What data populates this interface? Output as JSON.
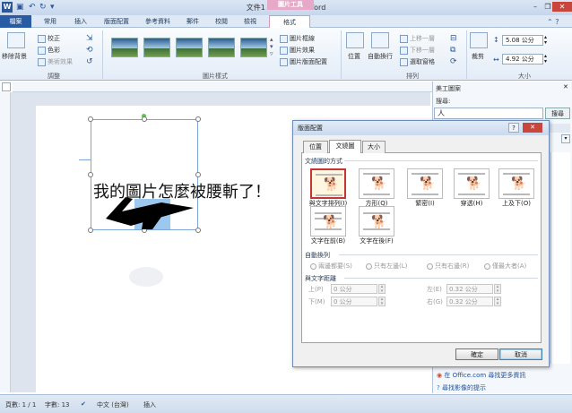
{
  "window": {
    "title": "文件1 - Microsoft Word",
    "context_tab_group": "圖片工具",
    "controls": [
      "–",
      "❐",
      "✕"
    ]
  },
  "tabs": [
    "檔案",
    "常用",
    "插入",
    "版面配置",
    "參考資料",
    "郵件",
    "校閱",
    "檢視",
    "格式"
  ],
  "ribbon": {
    "adjust": {
      "remove_bg": "移除背景",
      "correct": "校正",
      "color": "色彩",
      "effects": "美術效果",
      "group_label": "調整"
    },
    "styles": {
      "border": "圖片框線",
      "effects": "圖片效果",
      "layout": "圖片版面配置",
      "group_label": "圖片樣式"
    },
    "arrange": {
      "position": "位置",
      "wrap": "自動換行",
      "bring_forward": "上移一層",
      "send_backward": "下移一層",
      "selection_pane": "選取窗格",
      "group_label": "排列"
    },
    "size": {
      "crop": "裁剪",
      "height": "5.08 公分",
      "width": "4.92 公分",
      "group_label": "大小"
    }
  },
  "document": {
    "text": "我的圖片怎麼被腰斬了！"
  },
  "task_pane": {
    "title": "美工圖案",
    "search_label": "搜尋:",
    "search_value": "人",
    "search_button": "搜尋",
    "link1": "在 Office.com 尋找更多資訊",
    "link2": "尋找影像的提示"
  },
  "dialog": {
    "title": "版面配置",
    "help": "?",
    "close": "✕",
    "tabs": [
      "位置",
      "文繞圖",
      "大小"
    ],
    "active_tab": "文繞圖",
    "wrap_section": "文繞圖的方式",
    "wrap_options": [
      {
        "label": "與文字排列(I)",
        "selected": true
      },
      {
        "label": "方形(Q)",
        "selected": false
      },
      {
        "label": "緊密(I)",
        "selected": false
      },
      {
        "label": "穿透(H)",
        "selected": false
      },
      {
        "label": "上及下(O)",
        "selected": false
      },
      {
        "label": "文字在前(B)",
        "selected": false
      },
      {
        "label": "文字在後(F)",
        "selected": false
      }
    ],
    "auto_wrap_section": "自動換列",
    "auto_wrap_options": [
      "兩邊都要(S)",
      "只有左邊(L)",
      "只有右邊(R)",
      "僅最大者(A)"
    ],
    "distance_section": "與文字距離",
    "distance": {
      "top_label": "上(P)",
      "top_value": "0 公分",
      "bottom_label": "下(M)",
      "bottom_value": "0 公分",
      "left_label": "左(E)",
      "left_value": "0.32 公分",
      "right_label": "右(G)",
      "right_value": "0.32 公分"
    },
    "ok": "確定",
    "cancel": "取消"
  },
  "status_bar": {
    "page": "頁數: 1 / 1",
    "words": "字數: 13",
    "language": "中文 (台灣)",
    "mode": "插入"
  },
  "colors": {
    "file_tab": "#2a5aa4",
    "context_tab": "#e7a9c8",
    "selection_border": "#c43535"
  }
}
